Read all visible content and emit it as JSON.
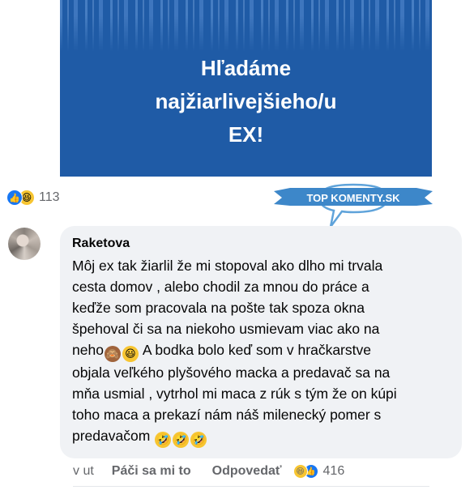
{
  "post_image": {
    "headline_lines": [
      "Hľadáme",
      "najžiarlivejšieho/u",
      "EX!"
    ],
    "background_color": "#1f5ba6"
  },
  "post_reactions": {
    "icons": [
      "like-icon",
      "haha-icon"
    ],
    "count": "113"
  },
  "watermark": {
    "text": "TOP KOMENTY.SK"
  },
  "comment": {
    "author": "Raketova",
    "lines": [
      "Môj ex tak žiarlil že mi stopoval ako dlho mi trvala",
      "cesta domov , alebo chodil za mnou do práce a",
      "keďže som pracovala na pošte  tak spoza okna",
      "špehoval či sa na niekoho usmievam viac ako na",
      "neho",
      " A bodka bolo keď som v hračkarstve",
      "objala veľkého plyšového macka a predavač sa na",
      "mňa usmial , vytrhol mi maca z rúk s tým že on kúpi",
      "toho maca a prekazí nám náš milenecký pomer s",
      "predavačom"
    ],
    "emojis_line5": [
      "monkey-emoji",
      "grinning-emoji"
    ],
    "emojis_line10": [
      "rofl-emoji",
      "rofl-emoji",
      "rofl-emoji"
    ]
  },
  "actions": {
    "time": "v ut",
    "like_label": "Páči sa mi to",
    "reply_label": "Odpovedať",
    "reaction_icons": [
      "haha-icon",
      "like-icon"
    ],
    "reaction_count": "416"
  }
}
